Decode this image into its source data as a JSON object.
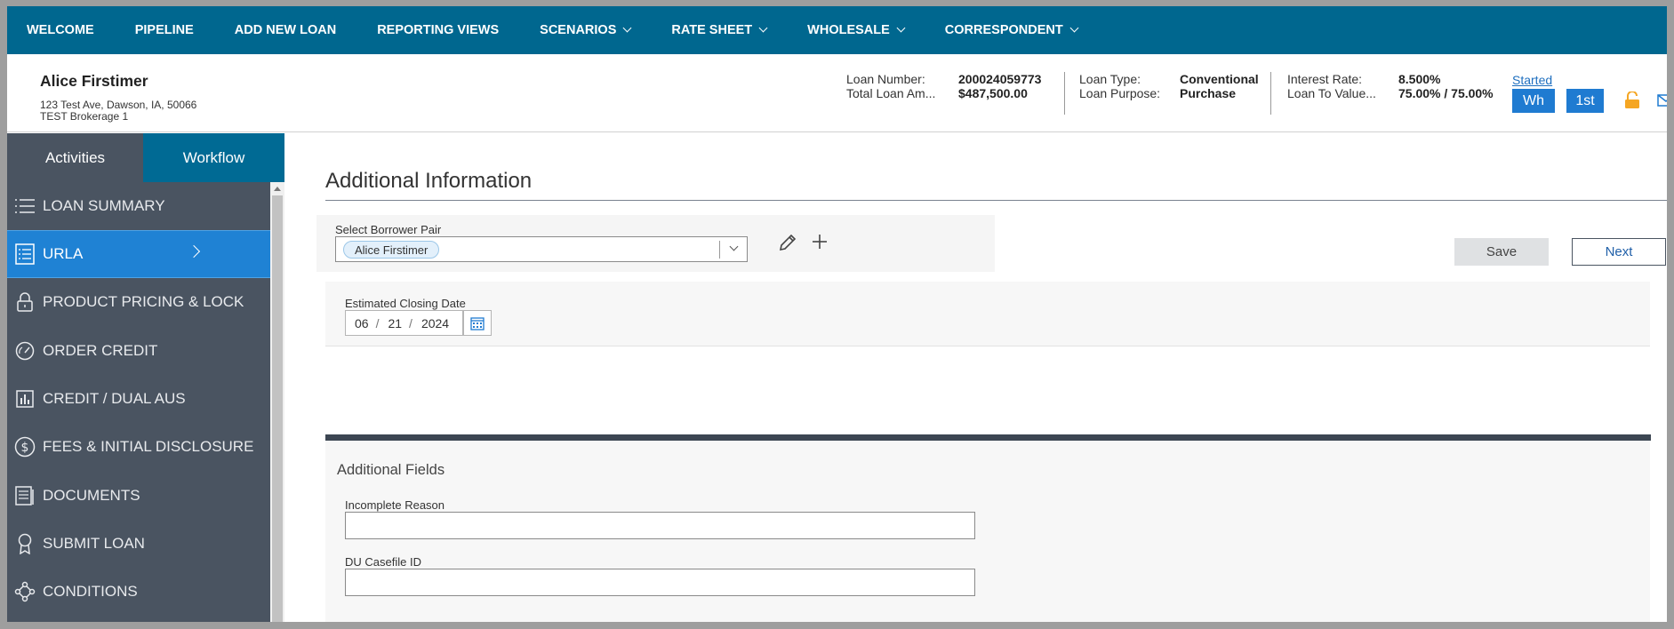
{
  "nav": {
    "items": [
      {
        "label": "WELCOME",
        "dropdown": false
      },
      {
        "label": "PIPELINE",
        "dropdown": false
      },
      {
        "label": "ADD NEW LOAN",
        "dropdown": false
      },
      {
        "label": "REPORTING VIEWS",
        "dropdown": false
      },
      {
        "label": "SCENARIOS",
        "dropdown": true
      },
      {
        "label": "RATE SHEET",
        "dropdown": true
      },
      {
        "label": "WHOLESALE",
        "dropdown": true
      },
      {
        "label": "CORRESPONDENT",
        "dropdown": true
      }
    ]
  },
  "header": {
    "borrower_name": "Alice Firstimer",
    "address_line1": "123 Test Ave, Dawson, IA, 50066",
    "address_line2": "TEST Brokerage 1",
    "loan_number_label": "Loan Number:",
    "loan_number": "200024059773",
    "total_loan_label": "Total Loan Am...",
    "total_loan": "$487,500.00",
    "loan_type_label": "Loan Type:",
    "loan_type": "Conventional",
    "loan_purpose_label": "Loan Purpose:",
    "loan_purpose": "Purchase",
    "interest_rate_label": "Interest Rate:",
    "interest_rate": "8.500%",
    "ltv_label": "Loan To Value...",
    "ltv": "75.00% / 75.00%",
    "status_link": "Started",
    "btn_wh": "Wh",
    "btn_1st": "1st"
  },
  "sidebar": {
    "tabs": [
      "Activities",
      "Workflow"
    ],
    "items": [
      {
        "label": "LOAN SUMMARY",
        "icon": "list-icon"
      },
      {
        "label": "URLA",
        "icon": "form-icon"
      },
      {
        "label": "PRODUCT PRICING & LOCK",
        "icon": "lock-icon"
      },
      {
        "label": "ORDER CREDIT",
        "icon": "gauge-icon"
      },
      {
        "label": "CREDIT / DUAL AUS",
        "icon": "bar-chart-icon"
      },
      {
        "label": "FEES & INITIAL DISCLOSURE",
        "icon": "dollar-icon"
      },
      {
        "label": "DOCUMENTS",
        "icon": "documents-icon"
      },
      {
        "label": "SUBMIT LOAN",
        "icon": "ribbon-icon"
      },
      {
        "label": "CONDITIONS",
        "icon": "network-icon"
      }
    ]
  },
  "main": {
    "title": "Additional Information",
    "borrower_pair_label": "Select Borrower Pair",
    "borrower_pair_value": "Alice Firstimer",
    "save_label": "Save",
    "next_label": "Next",
    "closing_date_label": "Estimated Closing Date",
    "closing_date": {
      "month": "06",
      "day": "21",
      "year": "2024"
    },
    "additional_fields_title": "Additional Fields",
    "incomplete_reason_label": "Incomplete Reason",
    "incomplete_reason_value": "",
    "du_casefile_label": "DU Casefile ID",
    "du_casefile_value": ""
  },
  "colors": {
    "nav_bg": "#00678f",
    "sidebar_bg": "#4a5461",
    "sidebar_active": "#1f82d4",
    "workflow_tab": "#006a94",
    "lock_icon": "#f5a623"
  }
}
